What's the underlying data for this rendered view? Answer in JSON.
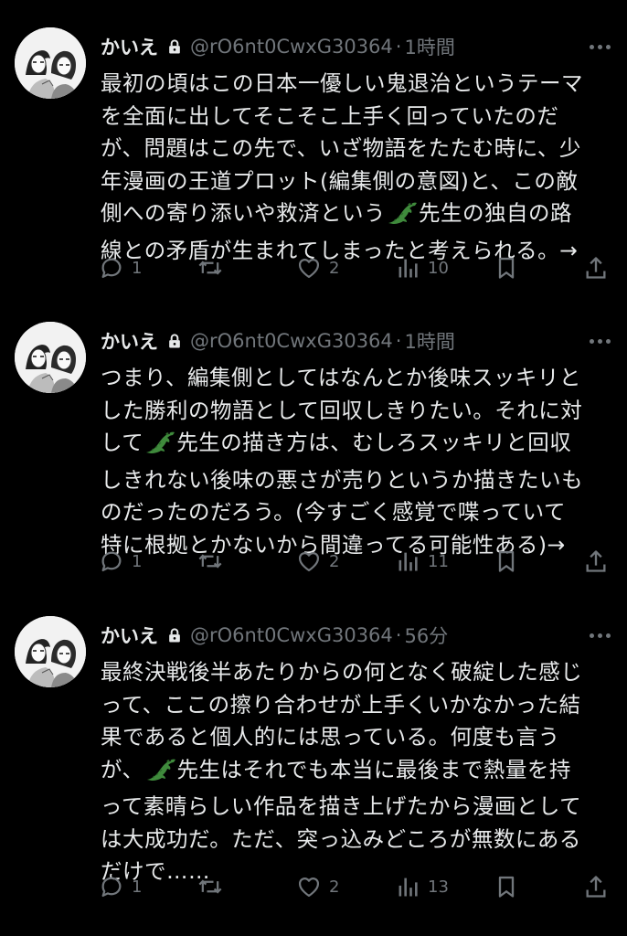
{
  "tweets": [
    {
      "name": "かいえ",
      "handle": "@rO6nt0CwxG30364",
      "dot": "·",
      "time": "1時間",
      "lines": [
        {
          "a": "最初の頃はこの日本一優しい鬼退治というテーマ"
        },
        {
          "a": "を全面に出してそこそこ上手く回っていたのだ"
        },
        {
          "a": "が、問題はこの先で、いざ物語をたたむ時に、少"
        },
        {
          "a": "年漫画の王道プロット(編集側の意図)と、この敵"
        },
        {
          "a": "側への寄り添いや救済という",
          "emoji": true,
          "b": "先生の独自の路"
        },
        {
          "a": "線との矛盾が生まれてしまったと考えられる。→"
        }
      ],
      "reply_count": "1",
      "retweet_count": "",
      "like_count": "2",
      "view_count": "10"
    },
    {
      "name": "かいえ",
      "handle": "@rO6nt0CwxG30364",
      "dot": "·",
      "time": "1時間",
      "lines": [
        {
          "a": "つまり、編集側としてはなんとか後味スッキリと"
        },
        {
          "a": "した勝利の物語として回収しきりたい。それに対"
        },
        {
          "a": "して",
          "emoji": true,
          "b": "先生の描き方は、むしろスッキリと回収"
        },
        {
          "a": "しきれない後味の悪さが売りというか描きたいも"
        },
        {
          "a": "のだったのだろう。(今すごく感覚で喋っていて"
        },
        {
          "a": "特に根拠とかないから間違ってる可能性ある)→"
        }
      ],
      "reply_count": "1",
      "retweet_count": "",
      "like_count": "2",
      "view_count": "11"
    },
    {
      "name": "かいえ",
      "handle": "@rO6nt0CwxG30364",
      "dot": "·",
      "time": "56分",
      "lines": [
        {
          "a": "最終決戦後半あたりからの何となく破綻した感じ"
        },
        {
          "a": "って、ここの擦り合わせが上手くいかなかった結"
        },
        {
          "a": "果であると個人的には思っている。何度も言う"
        },
        {
          "a": "が、",
          "emoji": true,
          "b": "先生はそれでも本当に最後まで熱量を持"
        },
        {
          "a": "って素晴らしい作品を描き上げたから漫画として"
        },
        {
          "a": "は大成功だ。ただ、突っ込みどころが無数にある"
        },
        {
          "a": "だけで……"
        }
      ],
      "reply_count": "1",
      "retweet_count": "",
      "like_count": "2",
      "view_count": "13"
    }
  ],
  "icons": [
    "reply-icon",
    "retweet-icon",
    "like-icon",
    "views-icon",
    "bookmark-icon",
    "share-icon",
    "lock-icon",
    "more-icon",
    "crocodile-emoji"
  ],
  "colors": {
    "background": "#000000",
    "text": "#e7e9ea",
    "secondary": "#71767b",
    "emoji": "#3f8a3c"
  }
}
